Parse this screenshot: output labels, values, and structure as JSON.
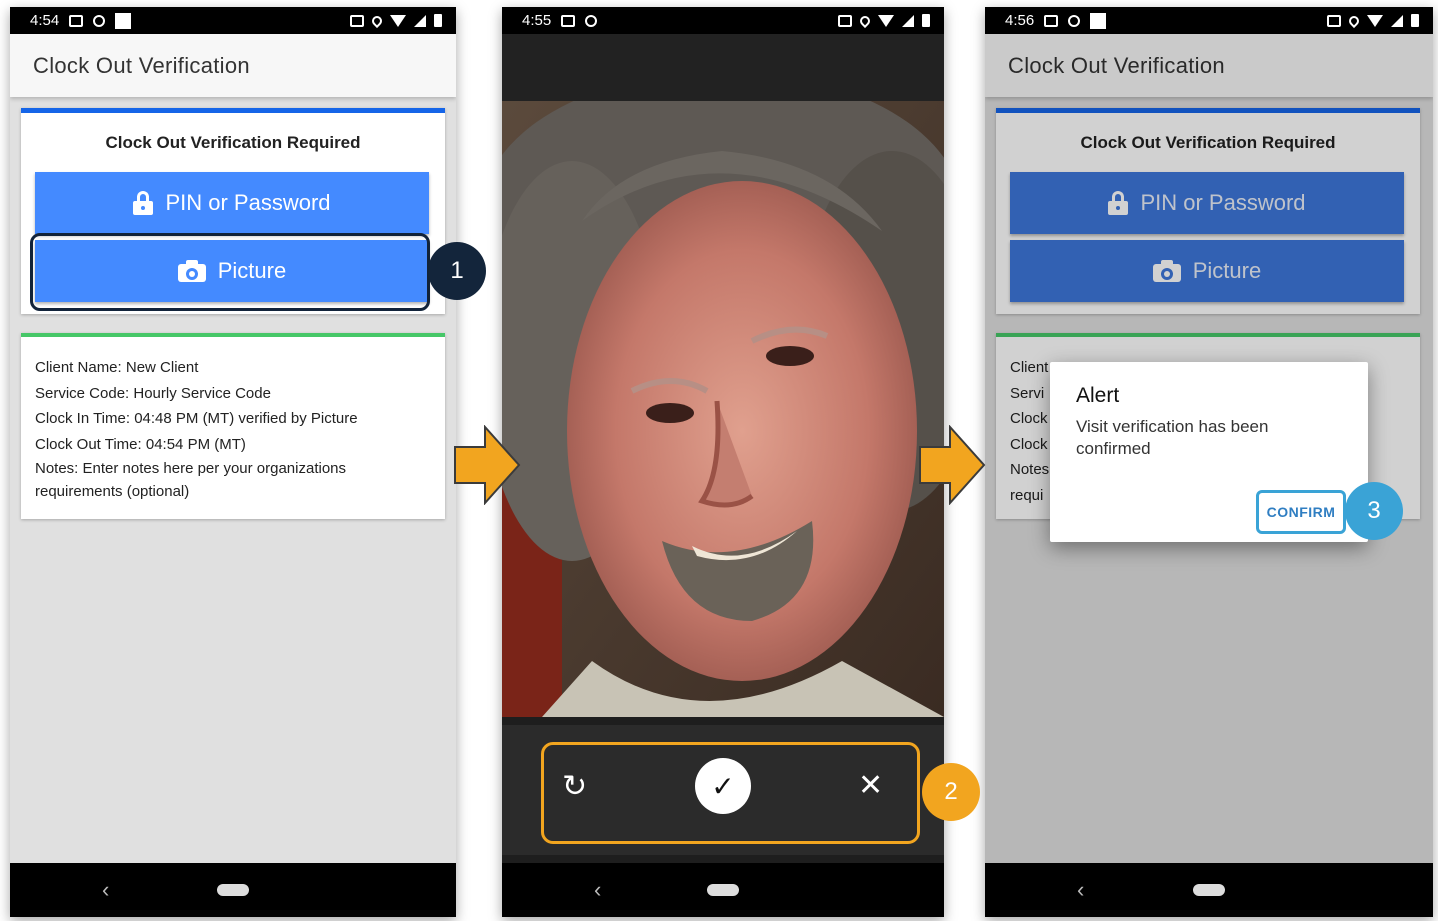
{
  "screens": [
    {
      "time": "4:54",
      "app_title": "Clock Out Verification",
      "verify_title": "Clock Out Verification Required",
      "pin_label": "PIN or Password",
      "picture_label": "Picture",
      "info": {
        "client": "Client Name: New Client",
        "service": "Service Code: Hourly Service Code",
        "clock_in": "Clock In Time: 04:48 PM (MT) verified by Picture",
        "clock_out": "Clock Out Time: 04:54 PM (MT)",
        "notes": "Notes: Enter notes here per your organizations requirements (optional)"
      },
      "nav_back": "‹"
    },
    {
      "time": "4:55",
      "retake_icon": "↻",
      "accept_icon": "✓",
      "cancel_icon": "✕",
      "nav_back": "‹"
    },
    {
      "time": "4:56",
      "app_title": "Clock Out Verification",
      "verify_title": "Clock Out Verification Required",
      "pin_label": "PIN or Password",
      "picture_label": "Picture",
      "info_partial": [
        "Client",
        "Servi",
        "Clock",
        "Clock",
        "Notes",
        "requi"
      ],
      "dialog": {
        "title": "Alert",
        "message": "Visit verification has been confirmed",
        "confirm": "CONFIRM"
      },
      "nav_back": "‹"
    }
  ],
  "badges": [
    "1",
    "2",
    "3"
  ],
  "colors": {
    "button_blue": "#448aff",
    "top_border_blue": "#1565e8",
    "green_border": "#46c768",
    "step1_navy": "#13253b",
    "step2_orange": "#f2a51f",
    "step3_teal": "#3aa3d6",
    "arrow_orange": "#f2a51f"
  }
}
